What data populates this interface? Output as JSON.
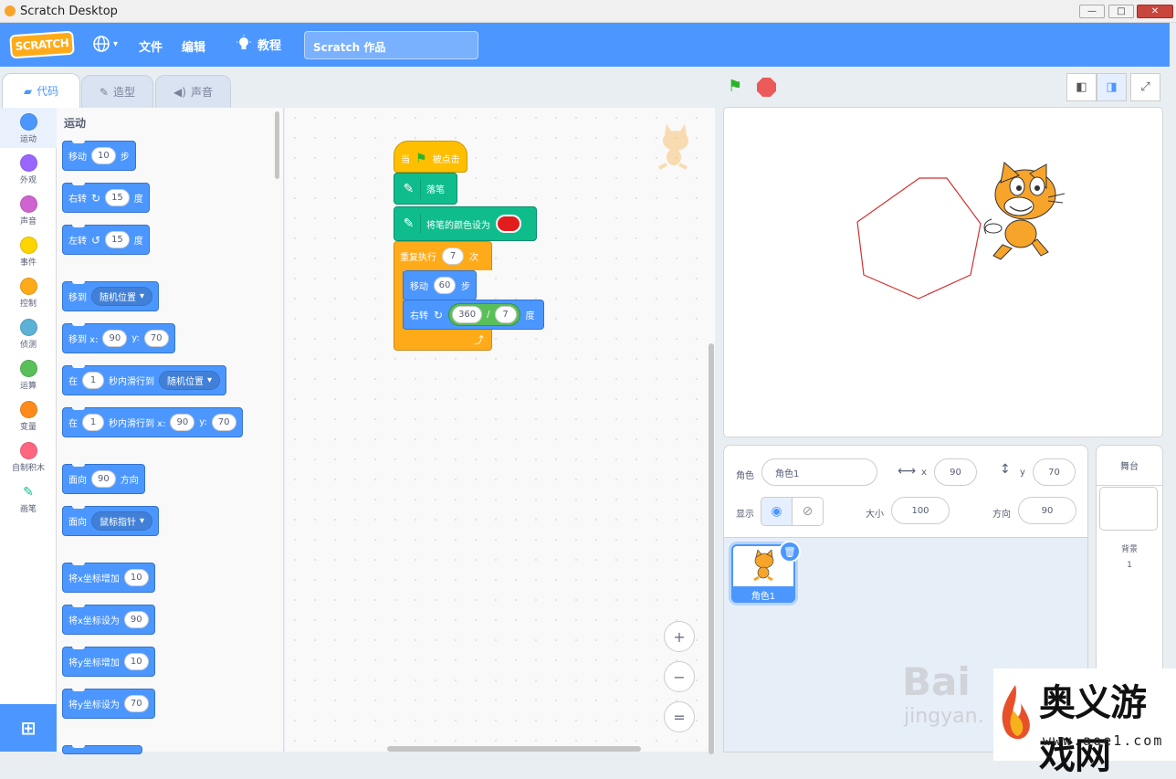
{
  "window": {
    "title": "Scratch Desktop",
    "min": "—",
    "max": "□",
    "close": "✕"
  },
  "menu": {
    "logo": "SCRATCH",
    "language_caret": "▾",
    "file": "文件",
    "edit": "编辑",
    "tutorials": "教程",
    "project_name": "Scratch 作品"
  },
  "tabs": [
    {
      "label": "代码"
    },
    {
      "label": "造型"
    },
    {
      "label": "声音"
    }
  ],
  "categories": [
    {
      "label": "运动",
      "color": "#4c97ff"
    },
    {
      "label": "外观",
      "color": "#9966ff"
    },
    {
      "label": "声音",
      "color": "#cf63cf"
    },
    {
      "label": "事件",
      "color": "#ffd500"
    },
    {
      "label": "控制",
      "color": "#ffab19"
    },
    {
      "label": "侦测",
      "color": "#5cb1d6"
    },
    {
      "label": "运算",
      "color": "#59c059"
    },
    {
      "label": "变量",
      "color": "#ff8c1a"
    },
    {
      "label": "自制积木",
      "color": "#ff6680"
    },
    {
      "label": "画笔",
      "color": "#0fbd8c"
    }
  ],
  "palette": {
    "title": "运动",
    "move": {
      "a": "移动",
      "v": "10",
      "b": "步"
    },
    "turn_right": {
      "a": "右转",
      "v": "15",
      "b": "度"
    },
    "turn_left": {
      "a": "左转",
      "v": "15",
      "b": "度"
    },
    "goto": {
      "a": "移到",
      "d": "随机位置"
    },
    "goto_xy": {
      "a": "移到 x:",
      "x": "90",
      "yl": "y:",
      "y": "70"
    },
    "glide": {
      "a": "在",
      "v": "1",
      "b": "秒内滑行到",
      "d": "随机位置"
    },
    "glide_xy": {
      "a": "在",
      "v": "1",
      "b": "秒内滑行到 x:",
      "x": "90",
      "yl": "y:",
      "y": "70"
    },
    "point": {
      "a": "面向",
      "v": "90",
      "b": "方向"
    },
    "point_towards": {
      "a": "面向",
      "d": "鼠标指针"
    },
    "change_x": {
      "a": "将x坐标增加",
      "v": "10"
    },
    "set_x": {
      "a": "将x坐标设为",
      "v": "90"
    },
    "change_y": {
      "a": "将y坐标增加",
      "v": "10"
    },
    "set_y": {
      "a": "将y坐标设为",
      "v": "70"
    }
  },
  "script": {
    "hat": {
      "a": "当",
      "b": "被点击"
    },
    "pen_down": "落笔",
    "set_pen_color": {
      "label": "将笔的颜色设为",
      "color": "#e11d1d"
    },
    "repeat": {
      "a": "重复执行",
      "v": "7",
      "b": "次"
    },
    "move": {
      "a": "移动",
      "v": "60",
      "b": "步"
    },
    "turn": {
      "a": "右转",
      "v1": "360",
      "op": "/",
      "v2": "7",
      "b": "度"
    }
  },
  "zoom": {
    "in": "+",
    "out": "−",
    "reset": "="
  },
  "sprite_info": {
    "sprite_label": "角色",
    "sprite_name": "角色1",
    "x_label": "x",
    "x": "90",
    "y_label": "y",
    "y": "70",
    "show_label": "显示",
    "size_label": "大小",
    "size": "100",
    "direction_label": "方向",
    "direction": "90"
  },
  "sprites": [
    {
      "name": "角色1"
    }
  ],
  "stage_panel": {
    "title": "舞台",
    "backdrop_label": "背景",
    "backdrop_count": "1"
  },
  "watermark": {
    "baidu": "Bai",
    "jingyan": "jingyan.",
    "aoyi": "奥义游戏网",
    "aoyi_url": "www.aoe1.com"
  }
}
